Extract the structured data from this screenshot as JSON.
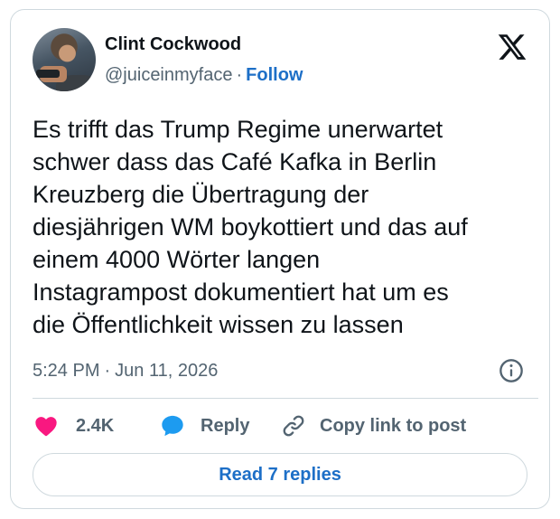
{
  "author": {
    "display_name": "Clint Cockwood",
    "handle": "@juiceinmyface",
    "separator": "·",
    "follow_label": "Follow"
  },
  "tweet": {
    "text_lines": [
      "Es trifft das Trump Regime unerwartet",
      "schwer dass das Café Kafka in Berlin",
      "Kreuzberg die Übertragung der",
      "diesjährigen WM boykottiert und das auf",
      "einem 4000 Wörter langen",
      "Instagrampost dokumentiert hat um es",
      "die Öffentlichkeit wissen zu lassen"
    ],
    "time": "5:24 PM",
    "date_separator": "·",
    "date": "Jun 11, 2026"
  },
  "actions": {
    "like_count": "2.4K",
    "reply_label": "Reply",
    "copy_link_label": "Copy link to post"
  },
  "read_replies_label": "Read 7 replies",
  "icons": {
    "logo": "x-logo-icon",
    "info": "info-icon",
    "like": "heart-icon",
    "reply": "reply-bubble-icon",
    "copy": "link-icon"
  },
  "colors": {
    "accent": "#1d6fc7",
    "like": "#f91880",
    "reply": "#1d9bf0",
    "muted_text": "#536471",
    "border": "#cfd9de"
  }
}
